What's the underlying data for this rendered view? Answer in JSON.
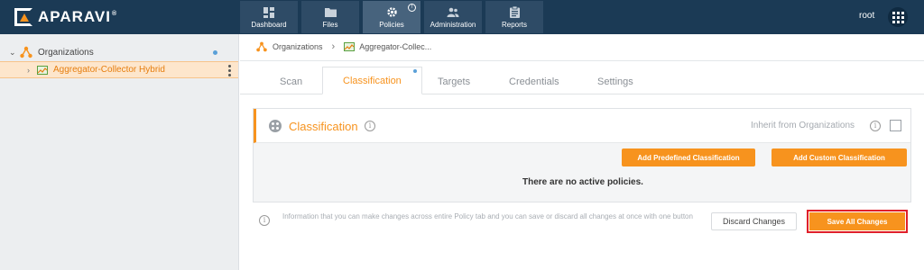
{
  "app": {
    "logo_text": "APARAVI",
    "logo_mark": "®"
  },
  "nav": {
    "items": [
      {
        "label": "Dashboard",
        "icon": "dashboard-icon"
      },
      {
        "label": "Files",
        "icon": "folder-icon"
      },
      {
        "label": "Policies",
        "icon": "gear-icon",
        "badge": "!"
      },
      {
        "label": "Administration",
        "icon": "users-icon"
      },
      {
        "label": "Reports",
        "icon": "clipboard-icon"
      }
    ],
    "active": "Policies"
  },
  "user": {
    "name": "root"
  },
  "sidebar": {
    "root_label": "Organizations",
    "child_label": "Aggregator-Collector Hybrid"
  },
  "breadcrumb": {
    "root": "Organizations",
    "current": "Aggregator-Collec..."
  },
  "tabs": [
    "Scan",
    "Classification",
    "Targets",
    "Credentials",
    "Settings"
  ],
  "active_tab": "Classification",
  "panel": {
    "title": "Classification",
    "inherit_label": "Inherit from Organizations",
    "inherit_checked": false,
    "add_predefined_label": "Add Predefined Classification",
    "add_custom_label": "Add Custom Classification",
    "empty_message": "There are no active policies."
  },
  "footer": {
    "info_text": "Information that you can make changes across entire Policy tab and you can save or discard all changes at once with one button",
    "discard_label": "Discard Changes",
    "save_label": "Save All Changes"
  },
  "colors": {
    "accent": "#f7931e",
    "topbar": "#1b3a55",
    "highlight": "#e0202a"
  }
}
